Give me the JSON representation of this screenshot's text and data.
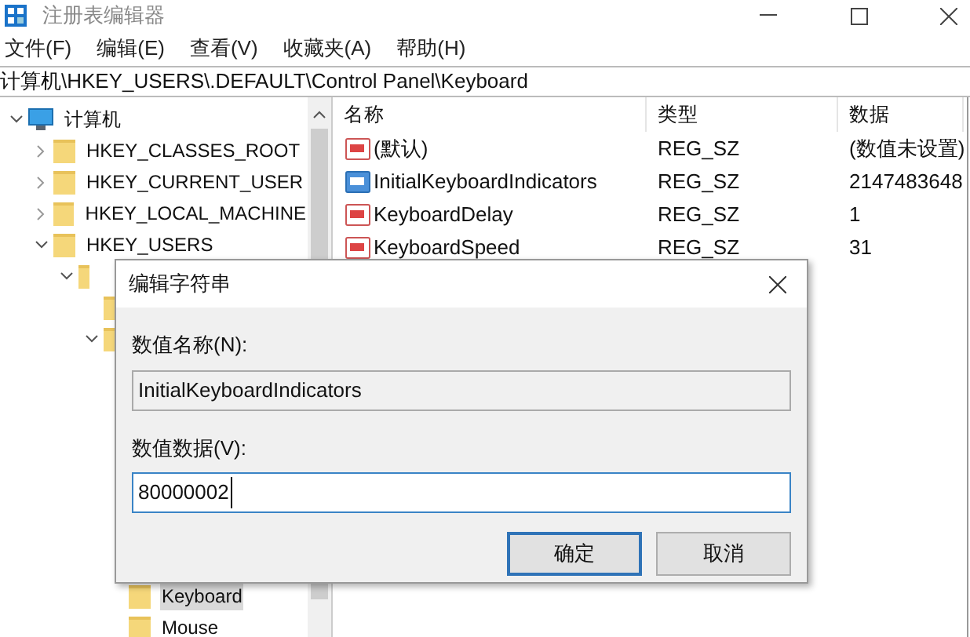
{
  "window": {
    "title": "注册表编辑器"
  },
  "menu": [
    "文件(F)",
    "编辑(E)",
    "查看(V)",
    "收藏夹(A)",
    "帮助(H)"
  ],
  "address": "计算机\\HKEY_USERS\\.DEFAULT\\Control Panel\\Keyboard",
  "tree": [
    {
      "label": "计算机",
      "kind": "computer",
      "expanded": true,
      "children": [
        {
          "label": "HKEY_CLASSES_ROOT",
          "kind": "folder",
          "expanded": false
        },
        {
          "label": "HKEY_CURRENT_USER",
          "kind": "folder",
          "expanded": false
        },
        {
          "label": "HKEY_LOCAL_MACHINE",
          "kind": "folder",
          "expanded": false
        },
        {
          "label": "HKEY_USERS",
          "kind": "folder",
          "expanded": true,
          "children": [
            {
              "kind": "folder",
              "expanded": true,
              "children": [
                {
                  "kind": "folder"
                },
                {
                  "kind": "folder",
                  "expanded": true,
                  "children": [
                    {
                      "label": "Keyboard",
                      "kind": "folder",
                      "selected": true
                    },
                    {
                      "label": "Mouse",
                      "kind": "folder",
                      "selected": false
                    }
                  ]
                }
              ]
            }
          ]
        }
      ]
    }
  ],
  "table": {
    "columns": [
      "名称",
      "类型",
      "数据"
    ],
    "rows": [
      {
        "name": "(默认)",
        "type": "REG_SZ",
        "data": "(数值未设置)",
        "selected": false
      },
      {
        "name": "InitialKeyboardIndicators",
        "type": "REG_SZ",
        "data": "2147483648",
        "selected": true
      },
      {
        "name": "KeyboardDelay",
        "type": "REG_SZ",
        "data": "1",
        "selected": false
      },
      {
        "name": "KeyboardSpeed",
        "type": "REG_SZ",
        "data": "31",
        "selected": false
      }
    ]
  },
  "dialog": {
    "title": "编辑字符串",
    "name_label": "数值名称(N):",
    "name_value": "InitialKeyboardIndicators",
    "data_label": "数值数据(V):",
    "data_value": "80000002",
    "buttons": [
      {
        "label": "确定",
        "default": true
      },
      {
        "label": "取消",
        "default": false
      }
    ]
  }
}
